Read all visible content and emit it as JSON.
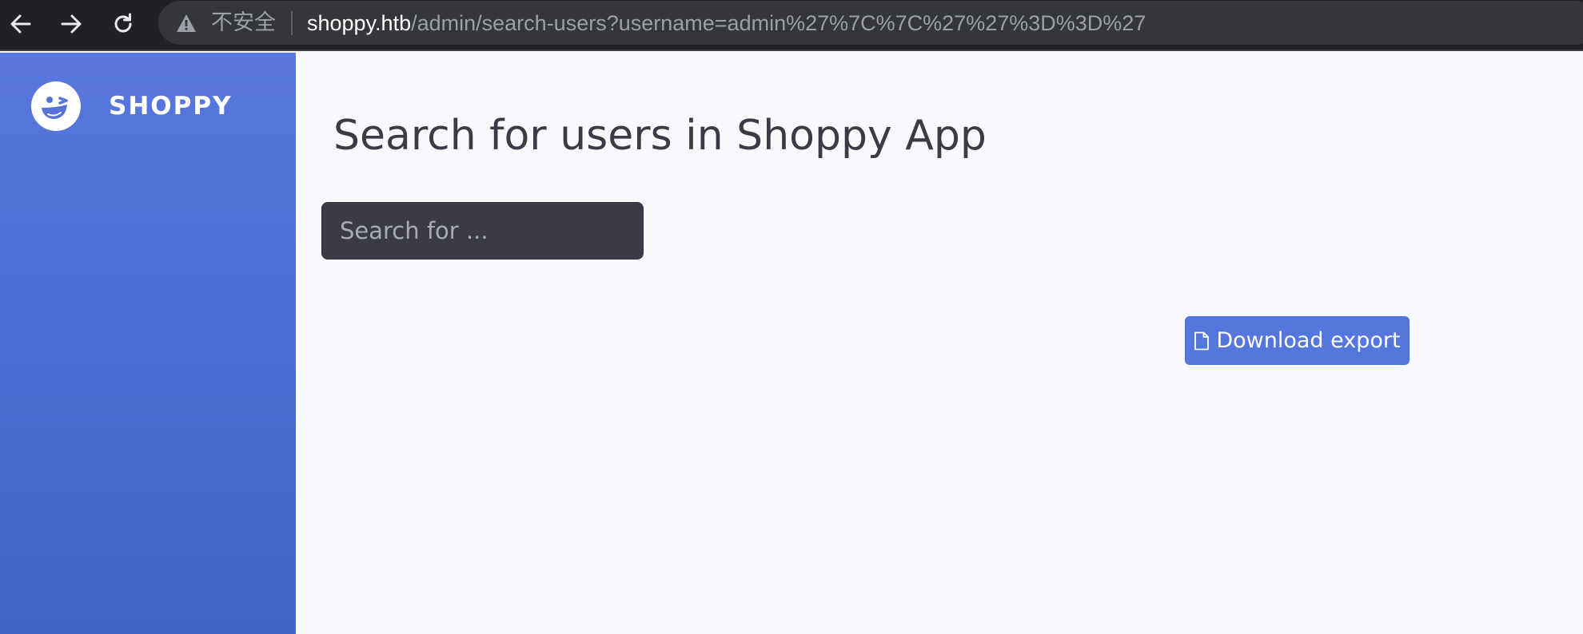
{
  "browser": {
    "security_label": "不安全",
    "url_host": "shoppy.htb",
    "url_path": "/admin/search-users?username=admin%27%7C%7C%27%27%3D%3D%27"
  },
  "sidebar": {
    "brand_name": "SHOPPY",
    "logo_icon": "wink-face-icon"
  },
  "main": {
    "title": "Search for users in Shoppy App",
    "search": {
      "placeholder": "Search for ...",
      "value": ""
    },
    "download_button": {
      "label": "Download export",
      "icon": "file-icon"
    }
  },
  "colors": {
    "sidebar_top": "#5a78dc",
    "sidebar_bottom": "#4363c9",
    "button_primary": "#5577dd",
    "input_dark": "#3a3b45",
    "page_background": "#f8f9fc"
  }
}
